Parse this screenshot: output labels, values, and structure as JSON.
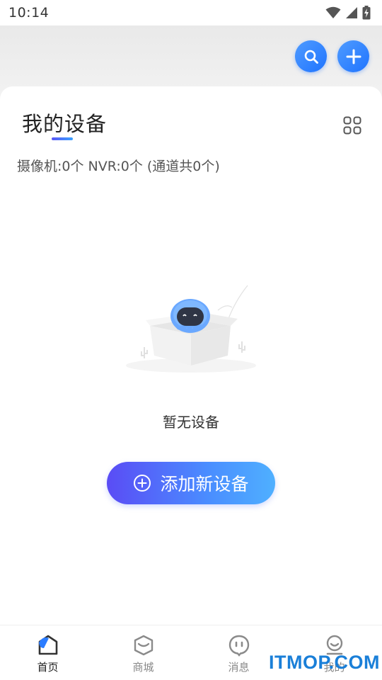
{
  "status_bar": {
    "time": "10:14",
    "icons": [
      "wifi-icon",
      "signal-icon",
      "battery-charging-icon"
    ]
  },
  "header": {
    "search_icon": "search-icon",
    "add_icon": "plus-icon",
    "accent_color": "#2b7cff"
  },
  "main": {
    "title": "我的设备",
    "view_toggle_icon": "grid-icon",
    "summary": "摄像机:0个 NVR:0个 (通道共0个)",
    "empty_text": "暂无设备",
    "add_button_label": "添加新设备",
    "add_button_icon": "plus-circle-icon"
  },
  "tab_bar": {
    "tabs": [
      {
        "label": "首页",
        "icon": "home-icon",
        "active": true
      },
      {
        "label": "商城",
        "icon": "shop-box-icon",
        "active": false
      },
      {
        "label": "消息",
        "icon": "message-icon",
        "active": false
      },
      {
        "label": "我的",
        "icon": "profile-icon",
        "active": false
      }
    ]
  },
  "watermark": "ITMOP.COM"
}
